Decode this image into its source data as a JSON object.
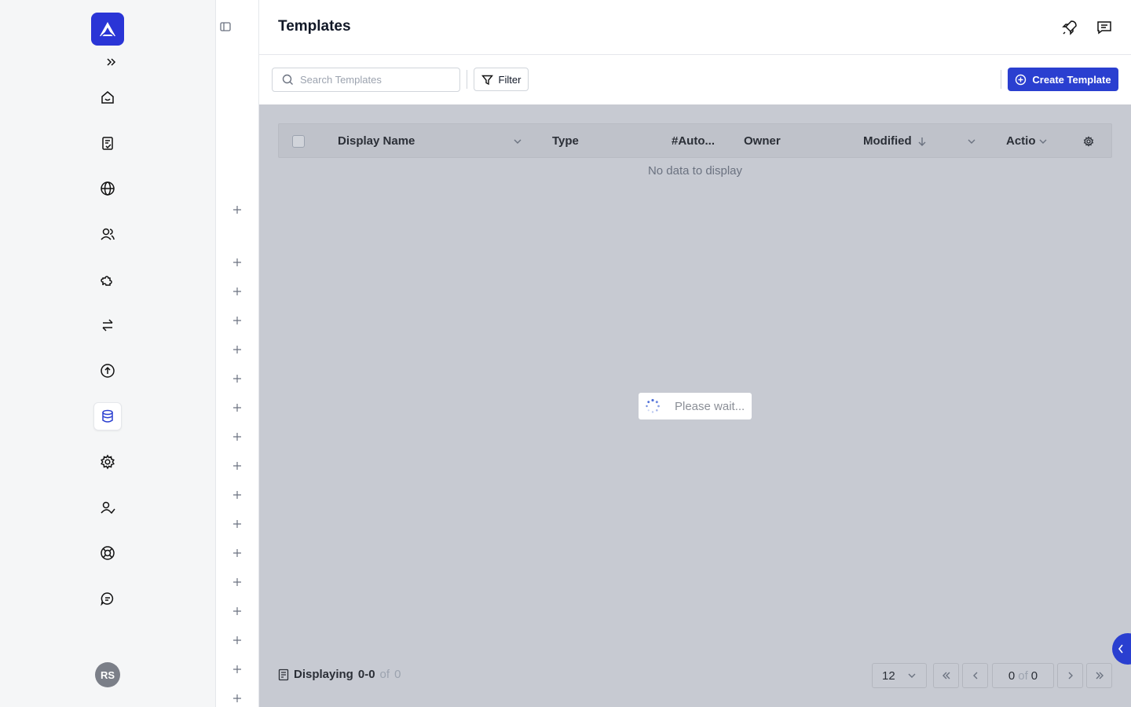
{
  "header": {
    "title": "Templates"
  },
  "toolbar": {
    "search_placeholder": "Search Templates",
    "filter_label": "Filter",
    "create_label": "Create Template"
  },
  "table": {
    "columns": [
      "Display Name",
      "Type",
      "#Auto...",
      "Owner",
      "Modified",
      "Actio"
    ],
    "empty_text": "No data to display"
  },
  "loading_text": "Please wait...",
  "footer": {
    "displaying_label": "Displaying",
    "range": "0-0",
    "of_label": "of",
    "total": "0",
    "page_size": "12",
    "page_current": "0",
    "page_of": "of",
    "page_total": "0"
  },
  "user": {
    "initials": "RS"
  },
  "colors": {
    "accent": "#2a3fd0",
    "overlay": "#c7cad2"
  },
  "nav_icons": [
    "home-icon",
    "tasks-icon",
    "globe-icon",
    "users-icon",
    "puzzle-icon",
    "transfer-icon",
    "upload-icon",
    "database-icon",
    "settings-icon",
    "user-check-icon",
    "support-icon",
    "chat-icon"
  ]
}
